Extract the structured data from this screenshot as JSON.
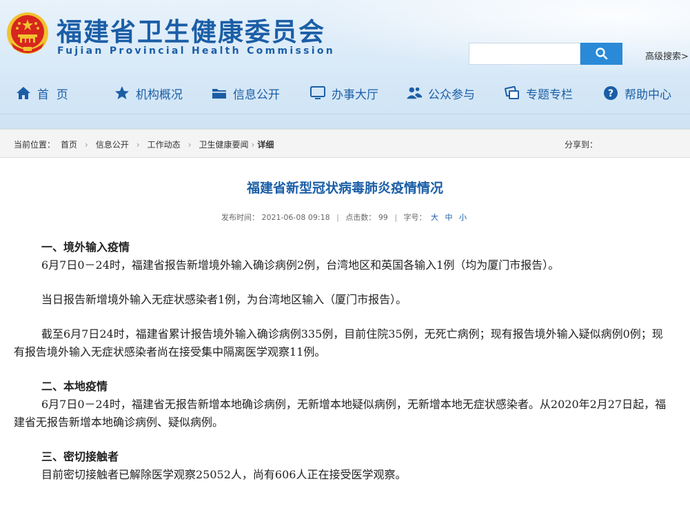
{
  "header": {
    "title": "福建省卫生健康委员会",
    "subtitle": "Fujian Provincial Health Commission",
    "search_placeholder": "",
    "advanced_search": "高级搜索>"
  },
  "nav": {
    "items": [
      {
        "label": "首  页",
        "icon": "home-icon"
      },
      {
        "label": "机构概况",
        "icon": "star-icon"
      },
      {
        "label": "信息公开",
        "icon": "folder-icon"
      },
      {
        "label": "办事大厅",
        "icon": "monitor-icon"
      },
      {
        "label": "公众参与",
        "icon": "people-icon"
      },
      {
        "label": "专题专栏",
        "icon": "chat-icon"
      },
      {
        "label": "帮助中心",
        "icon": "help-icon"
      }
    ]
  },
  "breadcrumb": {
    "prefix": "当前位置：",
    "items": [
      "首页",
      "信息公开",
      "工作动态",
      "卫生健康要闻"
    ],
    "current": "详细",
    "share": "分享到："
  },
  "article": {
    "title": "福建省新型冠状病毒肺炎疫情情况",
    "publish_label": "发布时间：",
    "publish_time": "2021-06-08 09:18",
    "clicks_label": "点击数：",
    "clicks": "99",
    "font_label": "字号：",
    "font_large": "大",
    "font_medium": "中",
    "font_small": "小",
    "sections": [
      {
        "heading": "一、境外输入疫情",
        "paragraphs": [
          "6月7日0－24时，福建省报告新增境外输入确诊病例2例，台湾地区和英国各输入1例（均为厦门市报告）。",
          "当日报告新增境外输入无症状感染者1例，为台湾地区输入（厦门市报告）。",
          "截至6月7日24时，福建省累计报告境外输入确诊病例335例，目前住院35例，无死亡病例；现有报告境外输入疑似病例0例；现有报告境外输入无症状感染者尚在接受集中隔离医学观察11例。"
        ]
      },
      {
        "heading": "二、本地疫情",
        "paragraphs": [
          "6月7日0－24时，福建省无报告新增本地确诊病例，无新增本地疑似病例，无新增本地无症状感染者。从2020年2月27日起，福建省无报告新增本地确诊病例、疑似病例。"
        ]
      },
      {
        "heading": "三、密切接触者",
        "paragraphs": [
          "目前密切接触者已解除医学观察25052人，尚有606人正在接受医学观察。"
        ]
      }
    ]
  },
  "colors": {
    "brand_blue": "#1b5ea6",
    "search_button": "#2a8ad8",
    "emblem_red": "#d7261e",
    "emblem_gold": "#f2c230"
  }
}
